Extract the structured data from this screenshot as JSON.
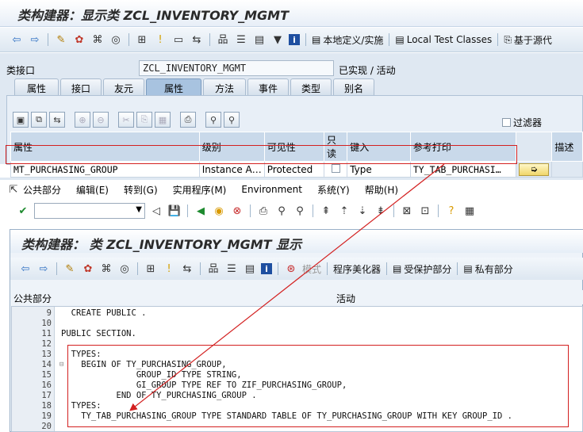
{
  "top": {
    "title": "类构建器：显示类 ZCL_INVENTORY_MGMT",
    "toolbar": {
      "local_def": "本地定义/实施",
      "local_test": "Local Test Classes",
      "based_on": "基于源代"
    },
    "form": {
      "class_interface_label": "类接口",
      "class_name": "ZCL_INVENTORY_MGMT",
      "status": "已实现 / 活动"
    },
    "tabs": [
      "属性",
      "接口",
      "友元",
      "属性",
      "方法",
      "事件",
      "类型",
      "别名"
    ],
    "filter_label": "过滤器",
    "table": {
      "headers": [
        "属性",
        "级别",
        "可见性",
        "只读",
        "键入",
        "参考打印",
        "描述"
      ],
      "row": {
        "attribute": "MT_PURCHASING_GROUP",
        "level": "Instance A…",
        "visibility": "Protected",
        "typing": "Type",
        "ref_type": "TY_TAB_PURCHASI…"
      }
    }
  },
  "bottom": {
    "menu": [
      "公共部分",
      "编辑(E)",
      "转到(G)",
      "实用程序(M)",
      "Environment",
      "系统(Y)",
      "帮助(H)"
    ],
    "title": "类构建器： 类 ZCL_INVENTORY_MGMT 显示",
    "toolbar": {
      "mode": "模式",
      "pretty_printer": "程序美化器",
      "protected_section": "受保护部分",
      "private_section": "私有部分"
    },
    "status": {
      "section": "公共部分",
      "state": "活动"
    },
    "code": [
      {
        "ln": "9",
        "text": "  CREATE PUBLIC ."
      },
      {
        "ln": "10",
        "text": ""
      },
      {
        "ln": "11",
        "text": "PUBLIC SECTION."
      },
      {
        "ln": "12",
        "text": ""
      },
      {
        "ln": "13",
        "text": "  TYPES:"
      },
      {
        "ln": "14",
        "text": "    BEGIN OF TY_PURCHASING_GROUP,"
      },
      {
        "ln": "15",
        "text": "               GROUP_ID TYPE STRING,"
      },
      {
        "ln": "16",
        "text": "               GI_GROUP TYPE REF TO ZIF_PURCHASING_GROUP,"
      },
      {
        "ln": "17",
        "text": "           END OF TY_PURCHASING_GROUP ."
      },
      {
        "ln": "18",
        "text": "  TYPES:"
      },
      {
        "ln": "19",
        "text": "    TY_TAB_PURCHASING_GROUP TYPE STANDARD TABLE OF TY_PURCHASING_GROUP WITH KEY GROUP_ID ."
      },
      {
        "ln": "20",
        "text": ""
      }
    ]
  },
  "colors": {
    "highlight_box": "#d32020",
    "keyword": "#1c1cc8",
    "header_bg": "#c9d9ea"
  }
}
